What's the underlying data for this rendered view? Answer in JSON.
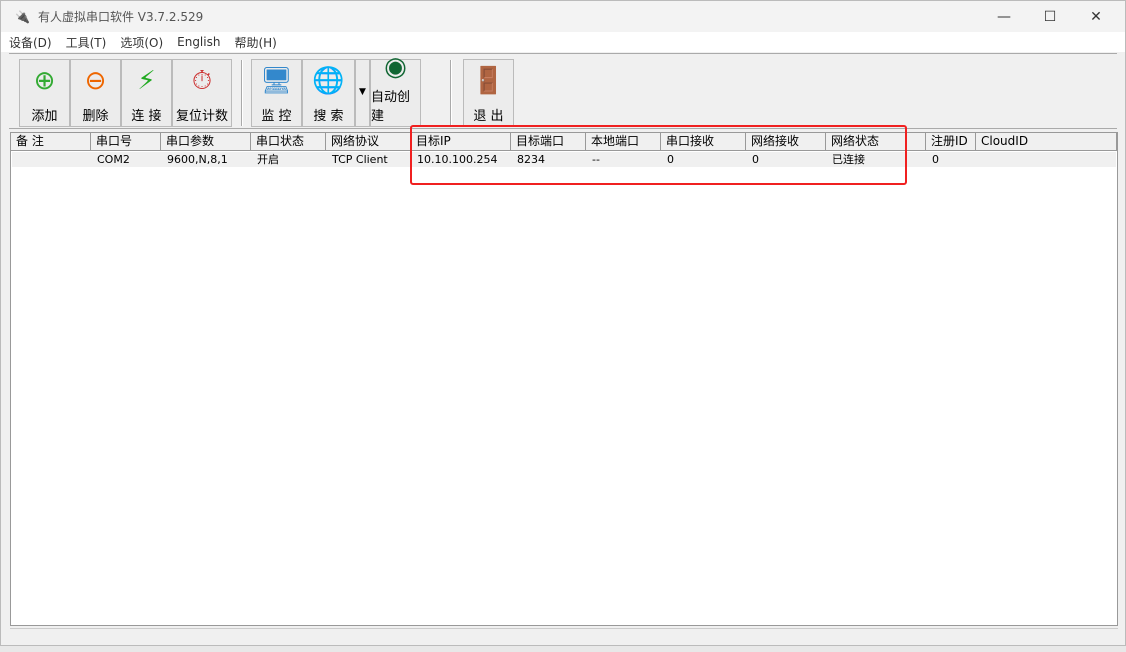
{
  "window": {
    "title": "有人虚拟串口软件 V3.7.2.529"
  },
  "menu": [
    "设备(D)",
    "工具(T)",
    "选项(O)",
    "English",
    "帮助(H)"
  ],
  "toolbar": {
    "add": "添加",
    "delete": "删除",
    "connect": "连 接",
    "reset": "复位计数",
    "monitor": "监 控",
    "search": "搜 索",
    "auto": "自动创建",
    "exit": "退 出"
  },
  "columns": [
    "备 注",
    "串口号",
    "串口参数",
    "串口状态",
    "网络协议",
    "目标IP",
    "目标端口",
    "本地端口",
    "串口接收",
    "网络接收",
    "网络状态",
    "注册ID",
    "CloudID"
  ],
  "rows": [
    [
      "",
      "COM2",
      "9600,N,8,1",
      "开启",
      "TCP Client",
      "10.10.100.254",
      "8234",
      "--",
      "0",
      "0",
      "已连接",
      "0",
      ""
    ]
  ],
  "colors": {
    "highlight": "#f02020"
  }
}
